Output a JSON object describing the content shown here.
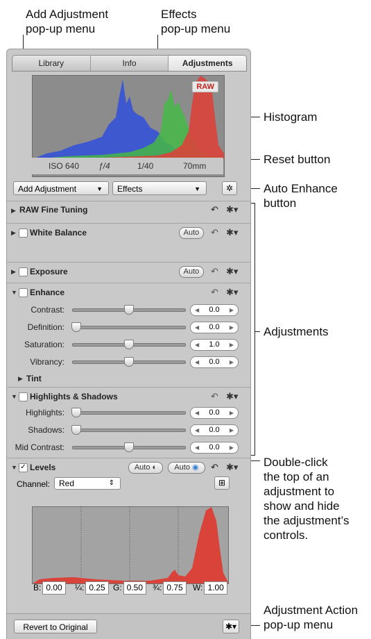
{
  "callouts": {
    "add_adjustment": [
      "Add Adjustment",
      "pop-up menu"
    ],
    "effects": [
      "Effects",
      "pop-up menu"
    ],
    "histogram": "Histogram",
    "reset_button": "Reset button",
    "auto_enhance": [
      "Auto Enhance",
      "button"
    ],
    "adjustments": "Adjustments",
    "double_click": [
      "Double-click",
      "the top of an",
      "adjustment to",
      "show and hide",
      "the adjustment’s",
      "controls."
    ],
    "adjustment_action": [
      "Adjustment Action",
      "pop-up menu"
    ]
  },
  "tabs": [
    "Library",
    "Info",
    "Adjustments"
  ],
  "histogram": {
    "badge": "RAW",
    "iso": "ISO 640",
    "aperture": "ƒ/4",
    "shutter": "1/40",
    "focal": "70mm"
  },
  "toolbar": {
    "add_adjustment": "Add Adjustment",
    "effects": "Effects"
  },
  "sections": {
    "raw_fine_tuning": "RAW Fine Tuning",
    "white_balance": "White Balance",
    "exposure": "Exposure",
    "enhance": "Enhance",
    "highlights_shadows": "Highlights & Shadows",
    "levels": "Levels",
    "auto": "Auto",
    "tint": "Tint"
  },
  "enhance_rows": [
    {
      "label": "Contrast:",
      "value": "0.0"
    },
    {
      "label": "Definition:",
      "value": "0.0"
    },
    {
      "label": "Saturation:",
      "value": "1.0"
    },
    {
      "label": "Vibrancy:",
      "value": "0.0"
    }
  ],
  "hs_rows": [
    {
      "label": "Highlights:",
      "value": "0.0"
    },
    {
      "label": "Shadows:",
      "value": "0.0"
    },
    {
      "label": "Mid Contrast:",
      "value": "0.0"
    }
  ],
  "levels": {
    "channel_label": "Channel:",
    "channel_value": "Red",
    "fields": [
      {
        "label": "B:",
        "value": "0.00"
      },
      {
        "label": "¼:",
        "value": "0.25"
      },
      {
        "label": "G:",
        "value": "0.50"
      },
      {
        "label": "¾:",
        "value": "0.75"
      },
      {
        "label": "W:",
        "value": "1.00"
      }
    ]
  },
  "bottom": {
    "revert": "Revert to Original"
  },
  "colors": {
    "red_channel": "#d9433a",
    "green_channel": "#45b845",
    "blue_channel": "#3552d6"
  },
  "icons": [
    "reset-icon",
    "gear-icon",
    "magic-wand-icon",
    "crosshair-icon",
    "chevron-down-icon"
  ]
}
